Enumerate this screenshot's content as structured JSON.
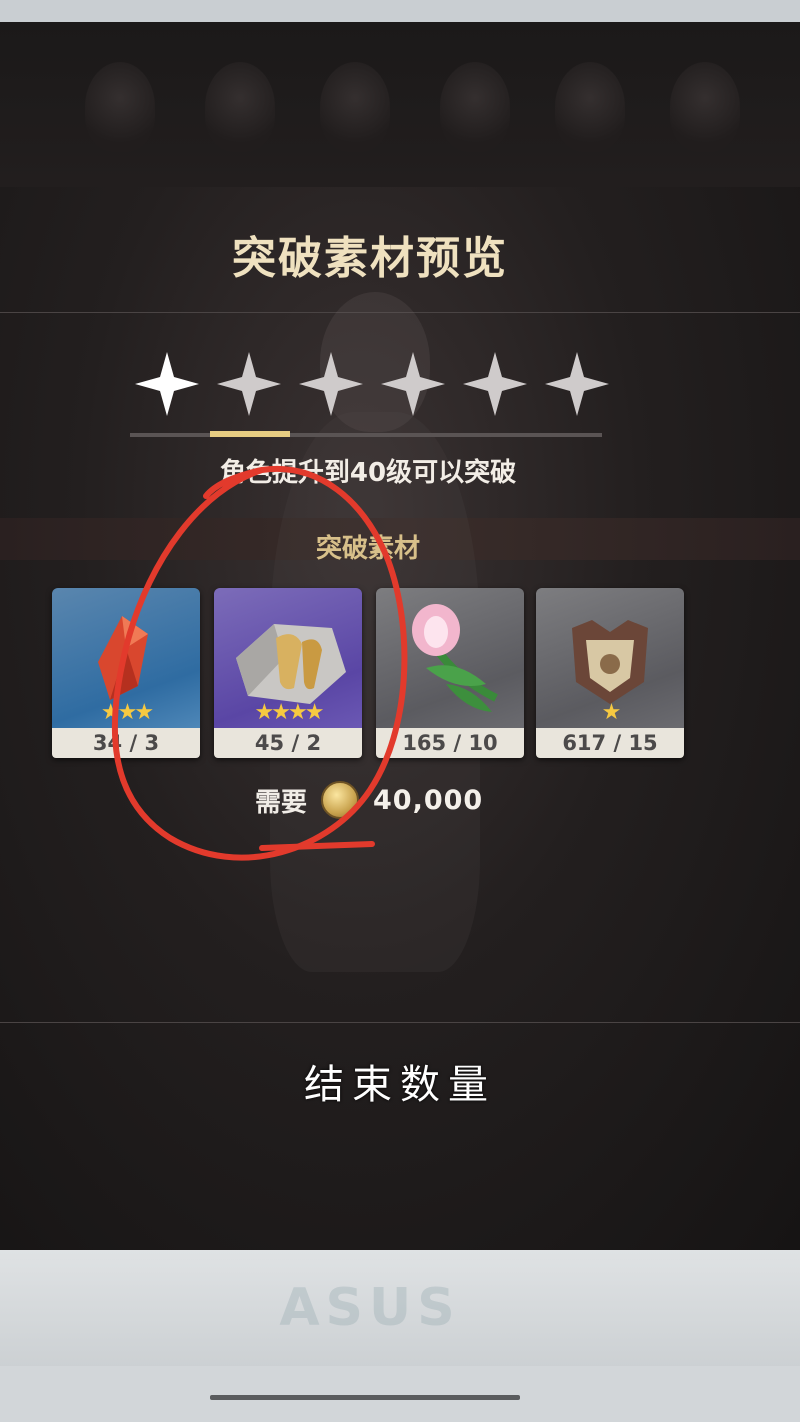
{
  "screen": {
    "title": "突破素材预览",
    "requirement_text": "角色提升到40级可以突破",
    "section_label": "突破素材",
    "ascension": {
      "phases_total": 6,
      "phases_completed": 1,
      "current_phase_progress": 1
    },
    "materials": [
      {
        "icon": "red-crystal-icon",
        "rarity_stars": "★★★",
        "count": "34 / 3",
        "color": "#2f6ca2"
      },
      {
        "icon": "purple-stone-icon",
        "rarity_stars": "★★★★",
        "count": "45 / 2",
        "color": "#5a46a5"
      },
      {
        "icon": "pink-flower-icon",
        "rarity_stars": "",
        "count": "165 / 10",
        "color": "#5b5b60"
      },
      {
        "icon": "mask-emblem-icon",
        "rarity_stars": "★",
        "count": "617 / 15",
        "color": "#5b5b60"
      }
    ],
    "cost": {
      "label": "需要",
      "currency_icon": "mora-coin-icon",
      "value": "40,000"
    }
  },
  "overlay": {
    "caption": "结束数量",
    "annotation_color": "#e23a2c"
  },
  "monitor": {
    "brand": "ASUS"
  }
}
